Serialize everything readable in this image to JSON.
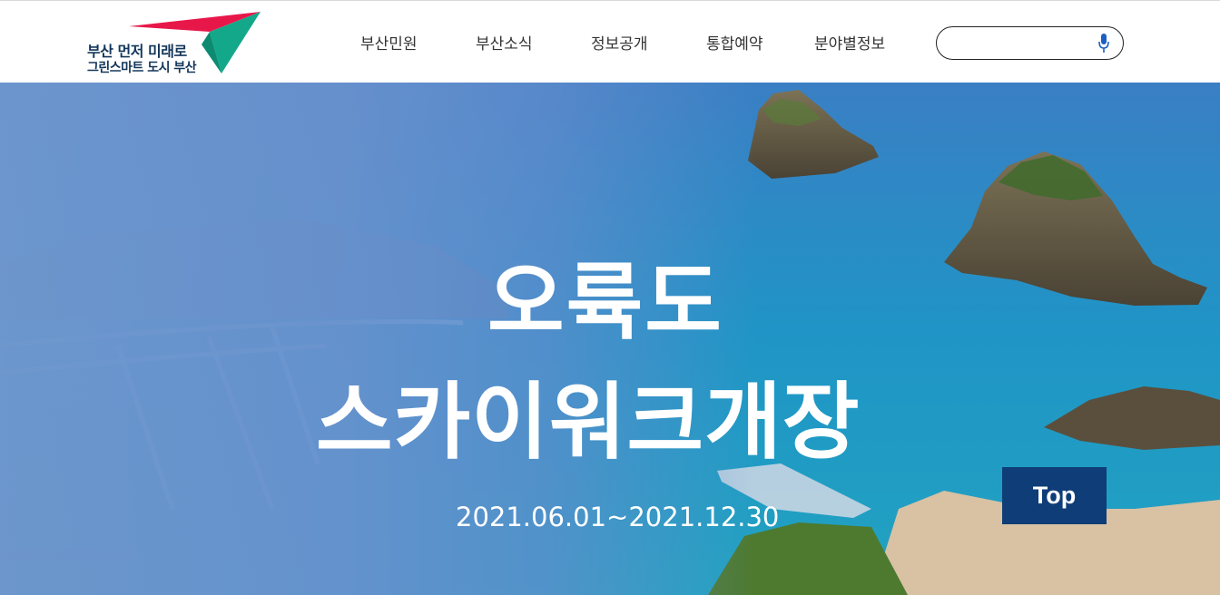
{
  "logo": {
    "line1": "부산 먼저 미래로",
    "line2": "그린스마트 도시 부산"
  },
  "nav": {
    "items": [
      {
        "label": "부산민원"
      },
      {
        "label": "부산소식"
      },
      {
        "label": "정보공개"
      },
      {
        "label": "통합예약"
      },
      {
        "label": "분야별정보"
      }
    ]
  },
  "search": {
    "value": "",
    "placeholder": "",
    "icon": "microphone-icon"
  },
  "hero": {
    "title_line1": "오륙도",
    "title_line2": "스카이워크개장",
    "date": "2021.06.01~2021.12.30"
  },
  "top_button": {
    "label": "Top"
  },
  "colors": {
    "logo_red": "#e8174a",
    "logo_green": "#14a88a",
    "logo_text": "#13365a",
    "top_button_bg": "#0f3d78",
    "sea": "#1f9ec3",
    "overlay": "#6e96cd"
  }
}
